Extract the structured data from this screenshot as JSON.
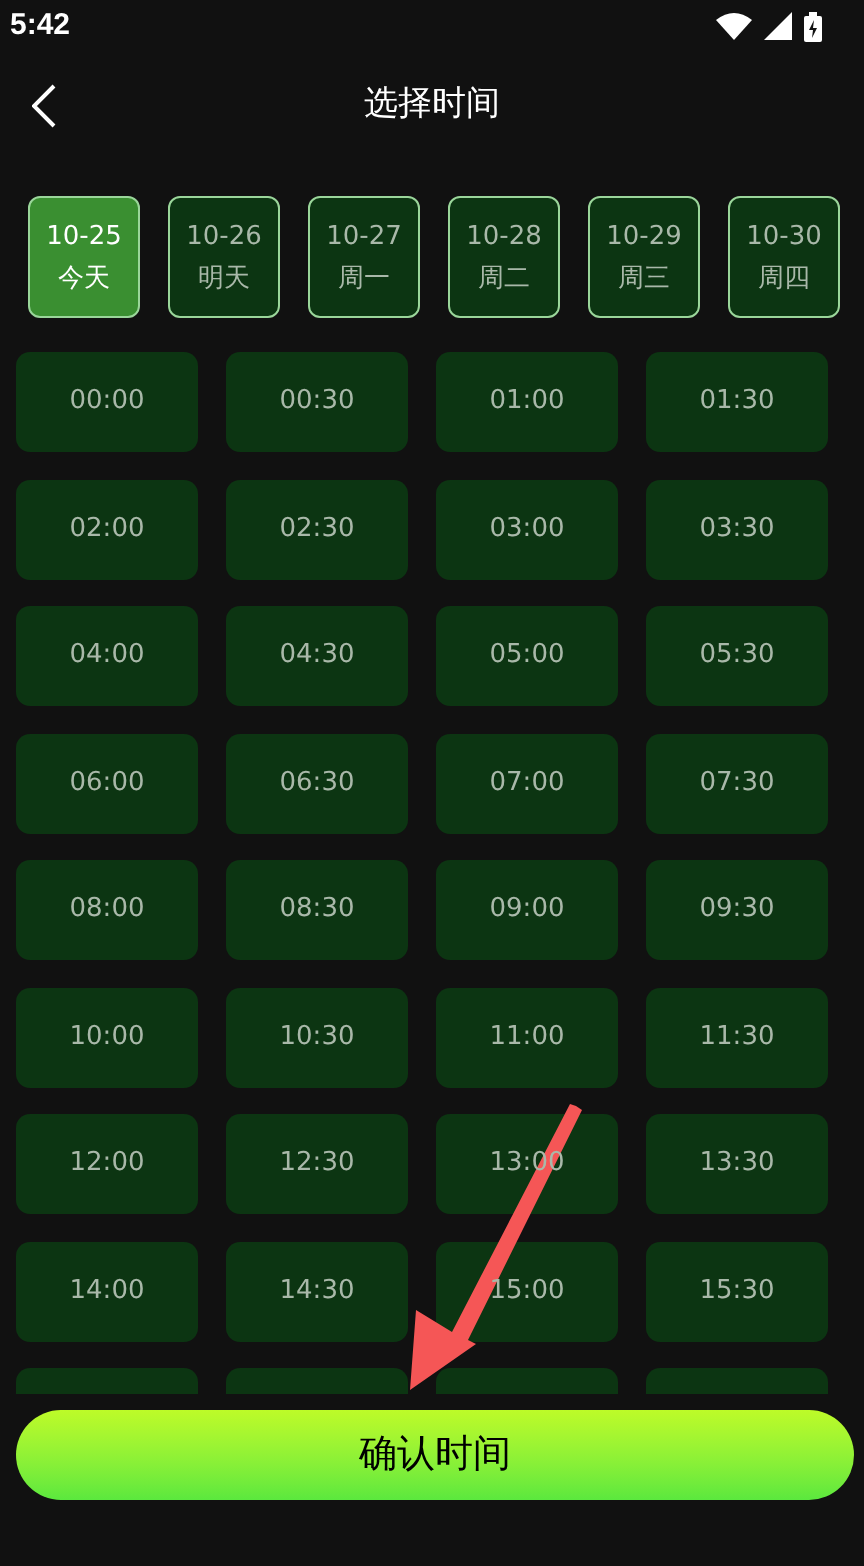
{
  "status_bar": {
    "time": "5:42"
  },
  "header": {
    "title": "选择时间"
  },
  "dates": [
    {
      "date": "10-25",
      "day": "今天",
      "selected": true
    },
    {
      "date": "10-26",
      "day": "明天",
      "selected": false
    },
    {
      "date": "10-27",
      "day": "周一",
      "selected": false
    },
    {
      "date": "10-28",
      "day": "周二",
      "selected": false
    },
    {
      "date": "10-29",
      "day": "周三",
      "selected": false
    },
    {
      "date": "10-30",
      "day": "周四",
      "selected": false
    }
  ],
  "slots": [
    {
      "kind": "slot",
      "time": "00:00",
      "selected": false
    },
    {
      "kind": "slot",
      "time": "00:30",
      "selected": false
    },
    {
      "kind": "slot",
      "time": "01:00",
      "selected": false
    },
    {
      "kind": "slot",
      "time": "01:30",
      "selected": false
    },
    {
      "kind": "slot",
      "time": "02:00",
      "selected": false
    },
    {
      "kind": "slot",
      "time": "02:30",
      "selected": false
    },
    {
      "kind": "slot",
      "time": "03:00",
      "selected": false
    },
    {
      "kind": "slot",
      "time": "03:30",
      "selected": false
    },
    {
      "kind": "slot",
      "time": "04:00",
      "selected": false
    },
    {
      "kind": "slot",
      "time": "04:30",
      "selected": false
    },
    {
      "kind": "slot",
      "time": "05:00",
      "selected": false
    },
    {
      "kind": "slot",
      "time": "05:30",
      "selected": false
    },
    {
      "kind": "slot",
      "time": "06:00",
      "selected": false
    },
    {
      "kind": "slot",
      "time": "06:30",
      "selected": false
    },
    {
      "kind": "slot",
      "time": "07:00",
      "selected": false
    },
    {
      "kind": "slot",
      "time": "07:30",
      "selected": false
    },
    {
      "kind": "slot",
      "time": "08:00",
      "selected": false
    },
    {
      "kind": "slot",
      "time": "08:30",
      "selected": false
    },
    {
      "kind": "slot",
      "time": "09:00",
      "selected": false
    },
    {
      "kind": "slot",
      "time": "09:30",
      "selected": false
    },
    {
      "kind": "slot",
      "time": "10:00",
      "selected": false
    },
    {
      "kind": "slot",
      "time": "10:30",
      "selected": false
    },
    {
      "kind": "slot",
      "time": "11:00",
      "selected": false
    },
    {
      "kind": "slot",
      "time": "11:30",
      "selected": false
    },
    {
      "kind": "slot",
      "time": "12:00",
      "selected": false
    },
    {
      "kind": "slot",
      "time": "12:30",
      "selected": false
    },
    {
      "kind": "slot",
      "time": "13:00",
      "selected": false
    },
    {
      "kind": "slot",
      "time": "13:30",
      "selected": false
    },
    {
      "kind": "slot",
      "time": "14:00",
      "selected": false
    },
    {
      "kind": "slot",
      "time": "14:30",
      "selected": false
    },
    {
      "kind": "slot",
      "time": "15:00",
      "selected": false
    },
    {
      "kind": "slot",
      "time": "15:30",
      "selected": false
    },
    {
      "kind": "cut"
    },
    {
      "kind": "cut"
    },
    {
      "kind": "cut"
    },
    {
      "kind": "cut"
    }
  ],
  "confirm_button": {
    "label": "确认时间"
  }
}
